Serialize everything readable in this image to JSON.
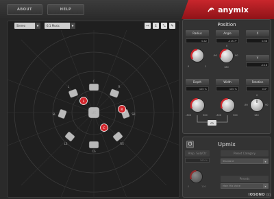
{
  "header": {
    "about_label": "ABOUT",
    "help_label": "HELP",
    "brand": "anymix"
  },
  "toolbar": {
    "input_format": "Stereo",
    "output_format": "6.1 Music"
  },
  "speakers": [
    {
      "label": "C"
    },
    {
      "label": "L"
    },
    {
      "label": "R"
    },
    {
      "label": "SL"
    },
    {
      "label": "SR"
    },
    {
      "label": "LFE"
    },
    {
      "label": "LS"
    },
    {
      "label": "RS"
    },
    {
      "label": "CS"
    }
  ],
  "sources": [
    {
      "label": "L"
    },
    {
      "label": "R"
    },
    {
      "label": "C"
    }
  ],
  "position": {
    "title": "Position",
    "radius": {
      "label": "Radius",
      "value": "0.42",
      "min": "0",
      "max": "1"
    },
    "angle": {
      "label": "Angle",
      "value": "-115.7°",
      "top": "0",
      "left": "-90",
      "right": "90",
      "bottom": "180"
    },
    "x": {
      "label": "X",
      "value": "0.38"
    },
    "y": {
      "label": "Y",
      "value": "-0.18"
    },
    "depth": {
      "label": "Depth",
      "value": "100 %",
      "min": "-300",
      "max": "300"
    },
    "width": {
      "label": "Width",
      "value": "100 %",
      "min": "-300",
      "max": "300"
    },
    "rotation": {
      "label": "Rotation",
      "value": "0.0°",
      "top": "0",
      "left": "-90",
      "right": "90",
      "bottom": "180"
    },
    "link_label": "co"
  },
  "upmix": {
    "title": "Upmix",
    "amp_label": "Amp. Sub/Ctr",
    "amp_value": "100 %",
    "preset_category_label": "Preset Category",
    "preset_category_value": "Standard",
    "amp_min": "0",
    "amp_max": "100",
    "presets_label": "Presets",
    "presets_value": "Main Mix Voice"
  },
  "footer": {
    "brand": "IOSONO"
  },
  "colors": {
    "accent": "#c8262c",
    "panel": "#333333",
    "canvas": "#1f1f1f"
  }
}
